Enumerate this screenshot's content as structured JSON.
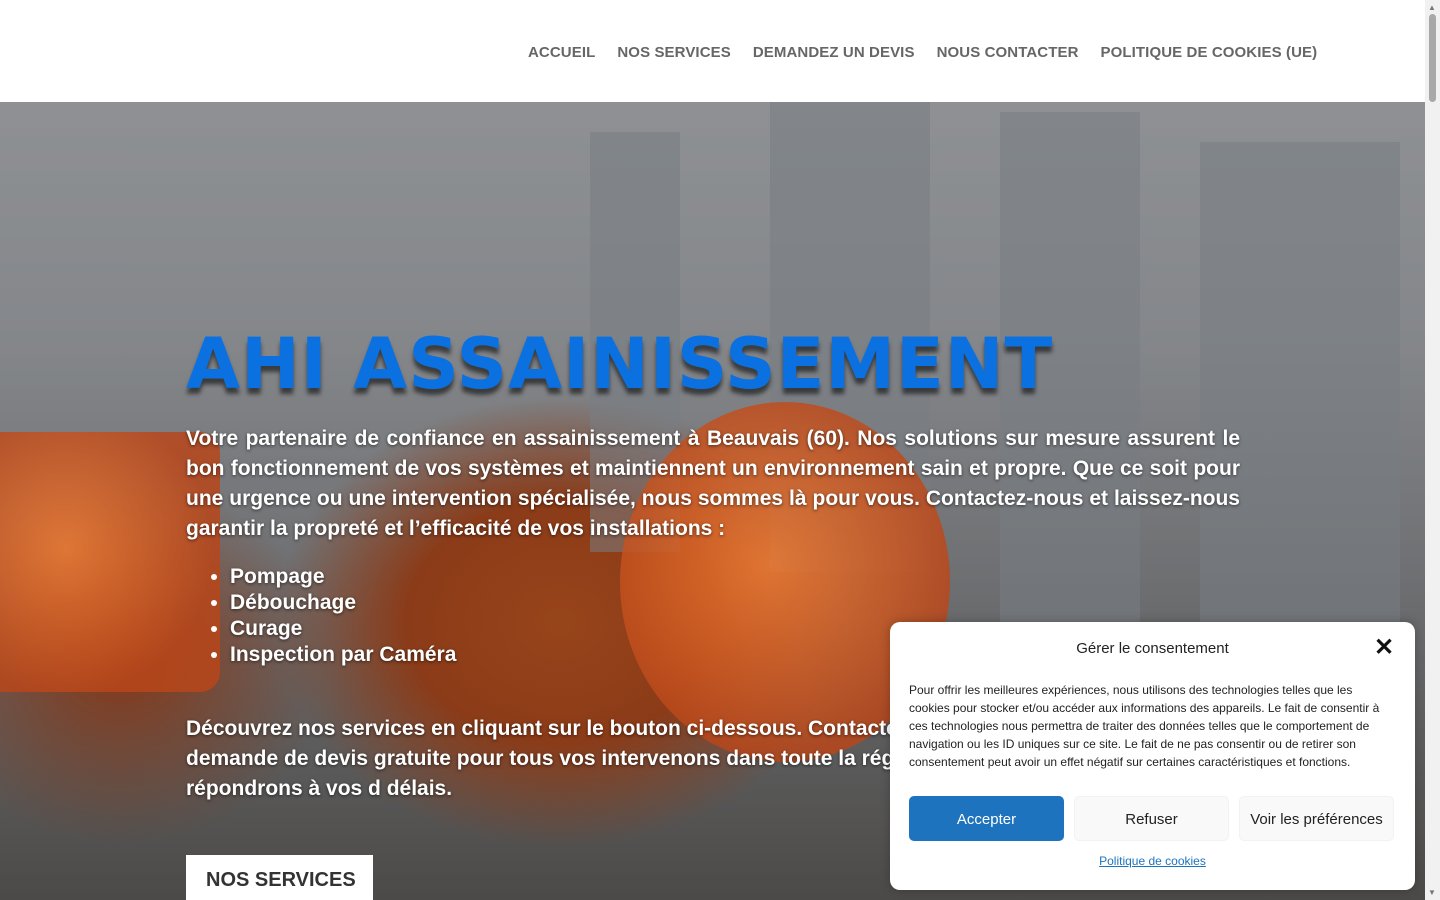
{
  "nav": {
    "items": [
      {
        "label": "ACCUEIL"
      },
      {
        "label": "NOS SERVICES"
      },
      {
        "label": "DEMANDEZ UN DEVIS"
      },
      {
        "label": "NOUS CONTACTER"
      },
      {
        "label": "POLITIQUE DE COOKIES (UE)"
      }
    ]
  },
  "hero": {
    "title": "AHI ASSAINISSEMENT",
    "intro": "Votre partenaire de confiance en assainissement à Beauvais (60). Nos solutions sur mesure assurent le bon fonctionnement de vos systèmes et maintiennent un environnement sain et propre. Que ce soit pour une urgence ou une intervention spécialisée, nous sommes là pour vous. Contactez-nous et laissez-nous garantir la propreté et l’efficacité de vos installations :",
    "services": [
      "Pompage",
      "Débouchage",
      "Curage",
      "Inspection par Caméra"
    ],
    "outro": "Découvrez nos services en cliquant sur le bouton ci-dessous. Contactez téléphone ou en envoyant une demande de devis gratuite pour tous vos intervenons dans toute la région de Beauvais (60) et répondrons à vos d délais.",
    "button_label": "NOS SERVICES",
    "title_color": "#0c71e0"
  },
  "consent": {
    "title": "Gérer le consentement",
    "text": "Pour offrir les meilleures expériences, nous utilisons des technologies telles que les cookies pour stocker et/ou accéder aux informations des appareils. Le fait de consentir à ces technologies nous permettra de traiter des données telles que le comportement de navigation ou les ID uniques sur ce site. Le fait de ne pas consentir ou de retirer son consentement peut avoir un effet négatif sur certaines caractéristiques et fonctions.",
    "accept_label": "Accepter",
    "refuse_label": "Refuser",
    "preferences_label": "Voir les préférences",
    "policy_link": "Politique de cookies",
    "accent_color": "#1e73be"
  }
}
